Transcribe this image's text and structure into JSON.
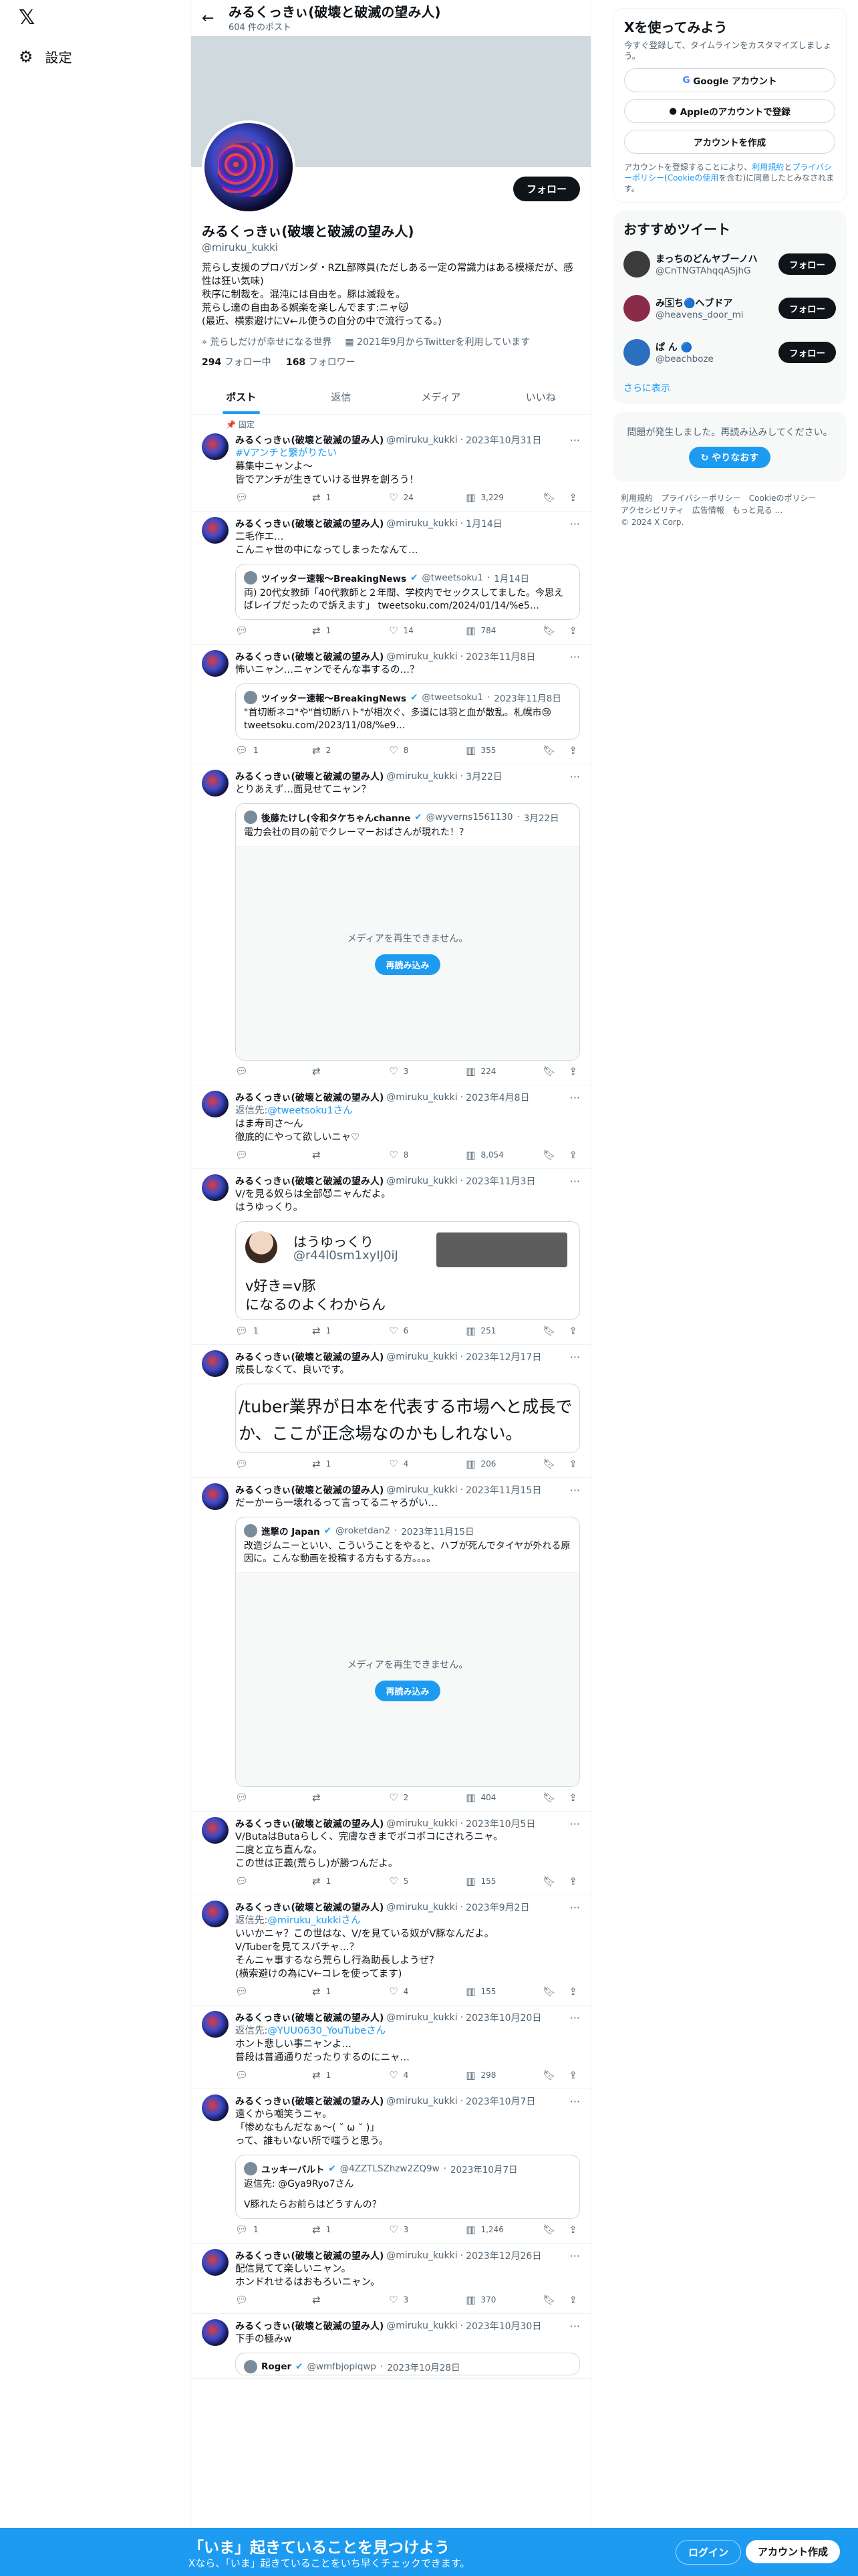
{
  "nav": {
    "logo": "𝕏",
    "settings_label": "設定"
  },
  "header": {
    "title": "みるくっきぃ(破壊と破滅の望み人)",
    "post_count": "604 件のポスト"
  },
  "profile": {
    "name": "みるくっきぃ(破壊と破滅の望み人)",
    "handle": "@miruku_kukki",
    "follow": "フォロー",
    "bio": "荒らし支援のプロパガンダ・RZL部隊員(ただしある一定の常識力はある模様だが、感性は狂い気味)\n秩序に制裁を。混沌には自由を。豚は滅殺を。\n荒らし達の自由ある娯楽を楽しんでます:ニャ🐱\n(最近、横索避けにV←ル使うの自分の中で流行ってる。)",
    "location": "荒らしだけが幸せになる世界",
    "joined": "2021年9月からTwitterを利用しています",
    "following_count": "294",
    "following_label": "フォロー中",
    "followers_count": "168",
    "followers_label": "フォロワー"
  },
  "tabs": [
    "ポスト",
    "返信",
    "メディア",
    "いいね"
  ],
  "pinned_label": "固定",
  "common": {
    "name": "みるくっきぃ(破壊と破滅の望み人)",
    "handle": "@miruku_kukki",
    "sep": "·",
    "more": "···",
    "reply_icon": "reply-icon",
    "retweet_icon": "retweet-icon",
    "like_icon": "heart-icon",
    "views_icon": "views-icon"
  },
  "tweets": [
    {
      "date": "2023年10月31日",
      "link": "#Vアンチと繋がりたい",
      "text": "募集中ニャンよ〜\n皆でアンチが生きていける世界を創ろう！",
      "replies": "",
      "retweets": "1",
      "likes": "24",
      "views": "3,229"
    },
    {
      "date": "1月14日",
      "text": "二毛作エ…\nこんニャ世の中になってしまったなんて…",
      "quote": {
        "name": "ツイッター速報〜BreakingNews",
        "handle": "@tweetsoku1",
        "date": "1月14日",
        "text": "両) 20代女教師「40代教師と２年間、学校内でセックスしてました。今思えばレイプだったので訴えます」 tweetsoku.com/2024/01/14/%e5…"
      },
      "replies": "",
      "retweets": "1",
      "likes": "14",
      "views": "784"
    },
    {
      "date": "2023年11月8日",
      "text": "怖いニャン…ニャンでそんな事するの…？",
      "quote": {
        "name": "ツイッター速報〜BreakingNews",
        "handle": "@tweetsoku1",
        "date": "2023年11月8日",
        "text": "\"首切断ネコ\"や\"首切断ハト\"が相次ぐ、多道には羽と血が散乱。札幌市😢 tweetsoku.com/2023/11/08/%e9…"
      },
      "replies": "1",
      "retweets": "2",
      "likes": "8",
      "views": "355"
    },
    {
      "date": "3月22日",
      "text": "とりあえず…面見せてニャン？",
      "quote": {
        "name": "後藤たけし(令和タケちゃんchanne",
        "handle": "@wyverns1561130",
        "date": "3月22日",
        "text": "電力会社の目の前でクレーマーおばさんが現れた！？",
        "media_msg": "メディアを再生できません。",
        "reload": "再読み込み"
      },
      "replies": "",
      "retweets": "",
      "likes": "3",
      "views": "224"
    },
    {
      "date": "2023年4月8日",
      "reply_to_label": "返信先:",
      "reply_to": "@tweetsoku1さん",
      "text": "はま寿司さ〜ん\n徹底的にやって欲しいニャ♡",
      "replies": "",
      "retweets": "",
      "likes": "8",
      "views": "8,054"
    },
    {
      "date": "2023年11月3日",
      "text": "V/を見る奴らは全部😈ニャんだよ。\nはうゆっくり。",
      "card": {
        "name": "はうゆっくり",
        "handle": "@r44l0sm1xyIJ0iJ",
        "big": "v好き=v豚\nになるのよくわからん"
      },
      "replies": "1",
      "retweets": "1",
      "likes": "6",
      "views": "251"
    },
    {
      "date": "2023年12月17日",
      "text": "成長しなくて、良いです。",
      "textimg": "/tuber業界が日本を代表する市場へと成長で\nか、ここが正念場なのかもしれない。",
      "replies": "",
      "retweets": "1",
      "likes": "4",
      "views": "206"
    },
    {
      "date": "2023年11月15日",
      "text": "だーかーら一壊れるって言ってるニャろがい…",
      "quote": {
        "name": "進撃の Japan",
        "handle": "@roketdan2",
        "date": "2023年11月15日",
        "text": "改造ジムニーといい、こういうことをやると、ハブが死んでタイヤが外れる原因に。こんな動画を投稿する方もする方。。。。",
        "media_msg": "メディアを再生できません。",
        "reload": "再読み込み"
      },
      "replies": "",
      "retweets": "",
      "likes": "2",
      "views": "404"
    },
    {
      "date": "2023年10月5日",
      "text": "V/ButaはButaらしく、完膚なきまでボコボコにされろニャ。\n二度と立ち直んな。\nこの世は正義(荒らし)が勝つんだよ。",
      "replies": "",
      "retweets": "1",
      "likes": "5",
      "views": "155"
    },
    {
      "date": "2023年9月2日",
      "reply_to_label": "返信先:",
      "reply_to": "@miruku_kukkiさん",
      "text": "いいかニャ？この世はな、V/を見ている奴がV豚なんだよ。\nV/Tuberを見てスパチャ…？\nそんニャ事するなら荒らし行為助長しようぜ？\n(横索避けの為にV←コレを使ってます)",
      "replies": "",
      "retweets": "1",
      "likes": "4",
      "views": "155"
    },
    {
      "date": "2023年10月20日",
      "reply_to_label": "返信先:",
      "reply_to": "@YUU0630_YouTubeさん",
      "text": "ホント悲しい事ニャンよ…\n普段は普通通りだったりするのにニャ…",
      "replies": "",
      "retweets": "1",
      "likes": "4",
      "views": "298"
    },
    {
      "date": "2023年10月7日",
      "text": "遠くから嘲笑うニャ。\n「惨めなもんだなぁ〜( ˘ ω ˘ )」\nって、誰もいない所で嗤うと思う。",
      "quote": {
        "name": "ユッキーバルト",
        "handle": "@4ZZTLSZhzw2ZQ9w",
        "date": "2023年10月7日",
        "reply_to": "返信先: @Gya9Ryo7さん",
        "text": "V豚れたらお前らはどうすんの？"
      },
      "replies": "1",
      "retweets": "1",
      "likes": "3",
      "views": "1,246"
    },
    {
      "date": "2023年12月26日",
      "text": "配信見てて楽しいニャン。\nホンドれせるはおもろいニャン。",
      "replies": "",
      "retweets": "",
      "likes": "3",
      "views": "370"
    },
    {
      "date": "2023年10月30日",
      "text": "下手の極みw",
      "quote": {
        "name": "Roger",
        "handle": "@wmfbjopiqwp",
        "date": "2023年10月28日",
        "text": ""
      }
    }
  ],
  "signup": {
    "title": "Xを使ってみよう",
    "sub": "今すぐ登録して、タイムラインをカスタマイズしましょう。",
    "google": "Google アカウント",
    "apple": "Appleのアカウントで登録",
    "create": "アカウントを作成",
    "legal_pre": "アカウントを登録することにより、",
    "legal_terms": "利用規約",
    "legal_and": "と",
    "legal_privacy": "プライバシーポリシー",
    "legal_cookie": "Cookieの使用",
    "legal_post": "を含む)に同意したとみなされます。"
  },
  "recs": {
    "title": "おすすめツイート",
    "items": [
      {
        "name": "まっちのどんヤブーノハ",
        "handle": "@CnTNGTAhqqASjhG",
        "follow": "フォロー"
      },
      {
        "name": "み🅂ち🔵ヘブドア",
        "handle": "@heavens_door_mi",
        "follow": "フォロー"
      },
      {
        "name": "ぱ ん 🔵",
        "handle": "@beachboze",
        "follow": "フォロー"
      }
    ],
    "more": "さらに表示"
  },
  "error": {
    "text": "問題が発生しました。再読み込みしてください。",
    "retry": "やりなおす"
  },
  "footer": [
    "利用規約",
    "プライバシーポリシー",
    "Cookieのポリシー",
    "アクセシビリティ",
    "広告情報",
    "もっと見る …",
    "© 2024 X Corp."
  ],
  "bottom": {
    "title": "「いま」起きていることを見つけよう",
    "sub": "Xなら、「いま」起きていることをいち早くチェックできます。",
    "login": "ログイン",
    "signup": "アカウント作成"
  }
}
